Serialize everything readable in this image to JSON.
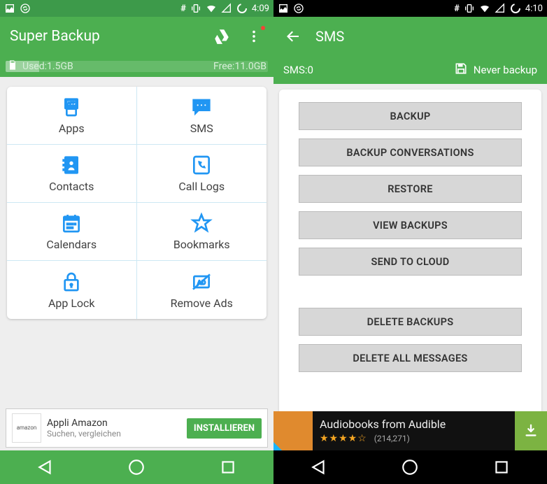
{
  "colors": {
    "primary": "#4caf50",
    "accent": "#2196f3"
  },
  "left": {
    "statusbar": {
      "time": "4:09",
      "hash": "#"
    },
    "toolbar": {
      "title": "Super Backup"
    },
    "storage": {
      "used_label": "Used:1.5GB",
      "free_label": "Free:11.0GB"
    },
    "grid": [
      {
        "icon": "apps-icon",
        "label": "Apps"
      },
      {
        "icon": "sms-icon",
        "label": "SMS"
      },
      {
        "icon": "contacts-icon",
        "label": "Contacts"
      },
      {
        "icon": "call-logs-icon",
        "label": "Call Logs"
      },
      {
        "icon": "calendar-icon",
        "label": "Calendars"
      },
      {
        "icon": "bookmark-icon",
        "label": "Bookmarks"
      },
      {
        "icon": "app-lock-icon",
        "label": "App Lock"
      },
      {
        "icon": "remove-ads-icon",
        "label": "Remove Ads"
      }
    ],
    "ad": {
      "brand": "amazon",
      "title": "Appli Amazon",
      "subtitle": "Suchen, vergleichen",
      "button": "INSTALLIEREN"
    }
  },
  "right": {
    "statusbar": {
      "time": "4:10",
      "hash": "#"
    },
    "toolbar": {
      "title": "SMS"
    },
    "subbar": {
      "count_label": "SMS:0",
      "never_backup": "Never backup"
    },
    "buttons": {
      "backup": "BACKUP",
      "backup_conversations": "BACKUP CONVERSATIONS",
      "restore": "RESTORE",
      "view_backups": "VIEW BACKUPS",
      "send_to_cloud": "SEND TO CLOUD",
      "delete_backups": "DELETE BACKUPS",
      "delete_all_messages": "DELETE ALL MESSAGES"
    },
    "ad": {
      "title": "Audiobooks from Audible",
      "stars": "★★★★☆",
      "count": "(214,271)"
    }
  }
}
